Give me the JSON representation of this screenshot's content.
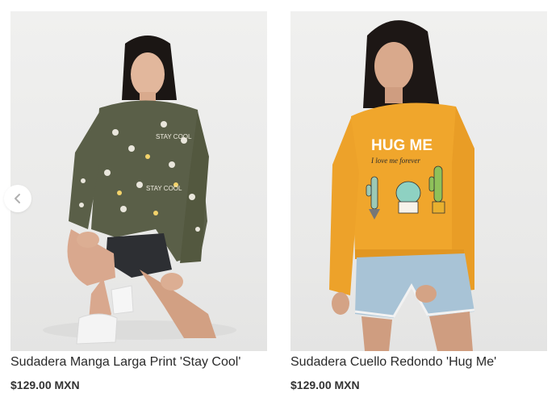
{
  "products": [
    {
      "title": "Sudadera Manga Larga Print 'Stay Cool'",
      "price": "$129.00 MXN",
      "sweater_color": "#5a5f48",
      "print_text": "STAY COOL"
    },
    {
      "title": "Sudadera Cuello Redondo 'Hug Me'",
      "price": "$129.00 MXN",
      "sweater_color": "#f0a62c",
      "print_heading": "HUG ME",
      "print_subtext": "I love me forever"
    }
  ],
  "carousel": {
    "prev_icon": "chevron-left-icon"
  }
}
